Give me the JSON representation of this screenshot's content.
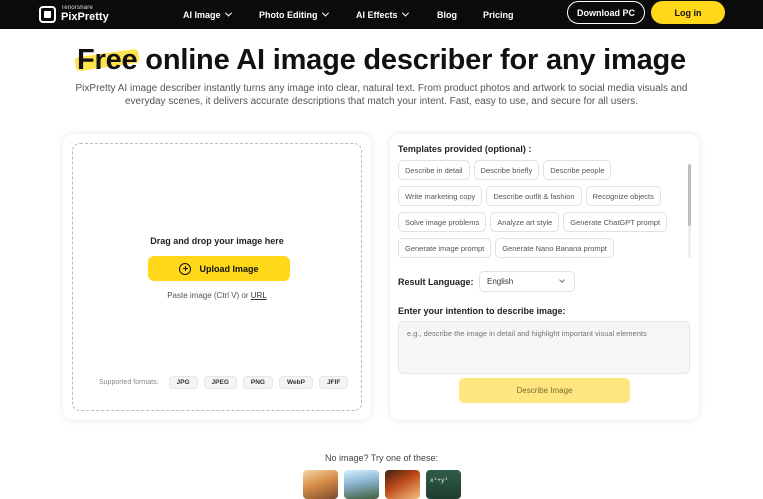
{
  "nav": {
    "brand_small": "Tenorshare",
    "brand": "PixPretty",
    "items": [
      "AI Image",
      "Photo Editing",
      "AI Effects",
      "Blog",
      "Pricing"
    ],
    "download_label": "Download PC",
    "login_label": "Log in"
  },
  "hero": {
    "title_highlight": "Free",
    "title_rest": " online AI image describer for any image",
    "description": "PixPretty AI image describer instantly turns any image into clear, natural text. From product photos and artwork to social media visuals and everyday scenes, it delivers accurate descriptions that match your intent. Fast, easy to use, and secure for all users."
  },
  "upload": {
    "drop_text": "Drag and drop your image here",
    "button_label": "Upload Image",
    "paste_text": "Paste image (Ctrl V) or ",
    "url_label": "URL",
    "formats_label": "Supported formats:",
    "formats": [
      "JPG",
      "JPEG",
      "PNG",
      "WebP",
      "JFIF"
    ]
  },
  "templates": {
    "label": "Templates provided (optional) :",
    "rows": [
      [
        "Describe in detail",
        "Describe briefly",
        "Describe people"
      ],
      [
        "Write marketing copy",
        "Describe outfit & fashion",
        "Recognize objects"
      ],
      [
        "Solve image problems",
        "Analyze art style",
        "Generate ChatGPT prompt"
      ],
      [
        "Generate image prompt",
        "Generate Nano Banana prompt"
      ]
    ]
  },
  "language": {
    "label": "Result Language:",
    "selected": "English"
  },
  "intent": {
    "label": "Enter your intention to describe image:",
    "placeholder": "e.g., describe the image in detail and highlight important visual elements"
  },
  "describe_button": "Describe Image",
  "samples": {
    "label": "No image? Try one of these:"
  },
  "colors": {
    "accent": "#ffd81a",
    "nav_bg": "#0b0b0b"
  }
}
